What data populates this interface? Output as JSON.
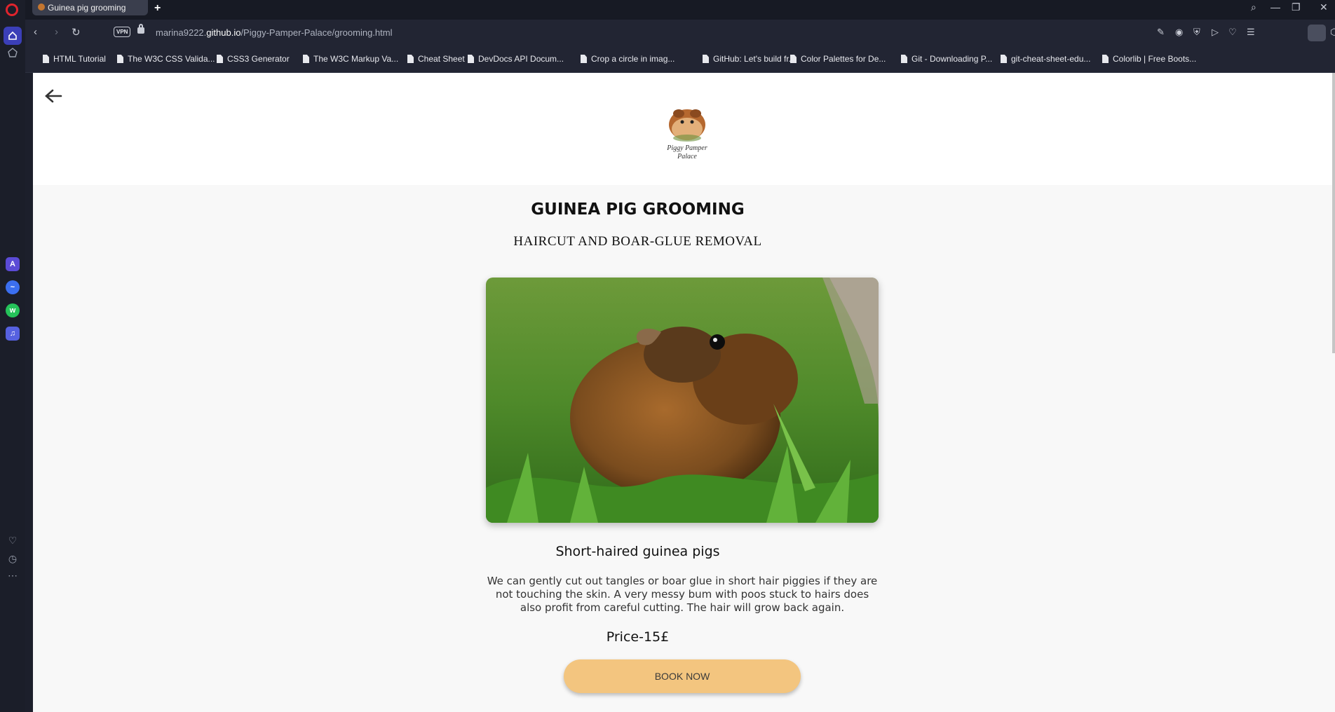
{
  "browser": {
    "tab_title": "Guinea pig grooming",
    "new_tab": "+",
    "url_prefix": "marina9222.",
    "url_host": "github.io",
    "url_path": "/Piggy-Pamper-Palace/grooming.html",
    "vpn_label": "VPN"
  },
  "bookmarks": [
    "HTML Tutorial",
    "The W3C CSS Valida...",
    "CSS3 Generator",
    "The W3C Markup Va...",
    "Cheat Sheet",
    "DevDocs API Docum...",
    "Crop a circle in imag...",
    "GitHub: Let's build fr...",
    "Color Palettes for De...",
    "Git - Downloading P...",
    "git-cheat-sheet-edu...",
    "Colorlib | Free Boots..."
  ],
  "page": {
    "logo_text_line1": "Piggy Pamper",
    "logo_text_line2": "Palace",
    "title": "GUINEA PIG GROOMING",
    "subtitle": "HAIRCUT AND BOAR-GLUE REMOVAL",
    "section_title": "Short-haired guinea pigs",
    "description": "We can gently cut out tangles or boar glue in short hair piggies if they are not touching the skin. A very messy bum with poos stuck to hairs does also profit from careful cutting. The hair will grow back again.",
    "price": "Price-15£",
    "book_button": "BOOK NOW"
  },
  "colors": {
    "button": "#f3c57f",
    "opera_red": "#e0242d",
    "sidebar_active": "#3b3fb8"
  }
}
